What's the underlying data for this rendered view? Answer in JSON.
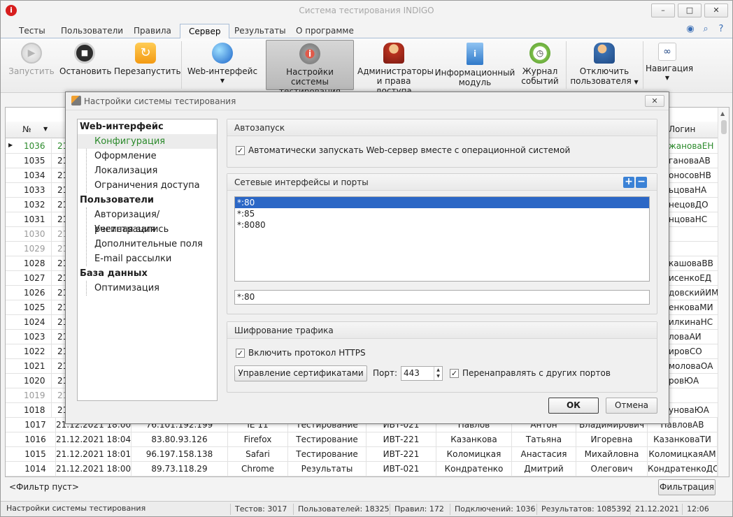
{
  "app": {
    "title": "Система тестирования INDIGO"
  },
  "window_buttons": [
    "–",
    "□",
    "✕"
  ],
  "tabs": [
    {
      "label": "Тесты",
      "active": false
    },
    {
      "label": "Пользователи",
      "active": false
    },
    {
      "label": "Правила",
      "active": false
    },
    {
      "label": "Сервер",
      "active": true
    },
    {
      "label": "Результаты",
      "active": false
    },
    {
      "label": "О программе",
      "active": false
    }
  ],
  "ribbon": {
    "start": "Запустить",
    "stop": "Остановить",
    "restart": "Перезапустить",
    "web": "Web-интерфейс",
    "settings_l1": "Настройки системы",
    "settings_l2": "тестирования",
    "admins_l1": "Администраторы",
    "admins_l2": "и права доступа",
    "info_l1": "Информационный",
    "info_l2": "модуль",
    "journal_l1": "Журнал",
    "journal_l2": "событий",
    "disconnect_l1": "Отключить",
    "disconnect_l2": "пользователя",
    "navigation": "Навигация"
  },
  "grid": {
    "col_no": "№",
    "col_login": "Логин",
    "rows": [
      {
        "no": "1036",
        "date": "21",
        "login": "жановаЕН",
        "sel": true
      },
      {
        "no": "1035",
        "date": "21",
        "login": "гановаАВ"
      },
      {
        "no": "1034",
        "date": "21",
        "login": "оносовНВ"
      },
      {
        "no": "1033",
        "date": "21",
        "login": "ьцоваНА"
      },
      {
        "no": "1032",
        "date": "21",
        "login": "нецовДО"
      },
      {
        "no": "1031",
        "date": "21",
        "login": "нцоваНС"
      },
      {
        "no": "1030",
        "date": "21",
        "login": "",
        "grey": true
      },
      {
        "no": "1029",
        "date": "21",
        "login": "",
        "grey": true
      },
      {
        "no": "1028",
        "date": "21",
        "login": "кашоваВВ"
      },
      {
        "no": "1027",
        "date": "21",
        "login": "исенкоЕД"
      },
      {
        "no": "1026",
        "date": "21",
        "login": "довскийИМ"
      },
      {
        "no": "1025",
        "date": "21",
        "login": "енковаМИ"
      },
      {
        "no": "1024",
        "date": "21",
        "login": "илкинаНС"
      },
      {
        "no": "1023",
        "date": "21",
        "login": "ловаАИ"
      },
      {
        "no": "1022",
        "date": "21",
        "login": "ировСО"
      },
      {
        "no": "1021",
        "date": "21",
        "login": "моловаОА"
      },
      {
        "no": "1020",
        "date": "21",
        "login": "ровЮА"
      },
      {
        "no": "1019",
        "date": "21",
        "login": "",
        "grey": true
      },
      {
        "no": "1018",
        "date": "21",
        "login": "уноваЮА"
      }
    ],
    "full_rows": [
      {
        "no": "1017",
        "date": "21.12.2021 18:00",
        "ip": "76.101.192.199",
        "browser": "IE 11",
        "mode": "Тестирование",
        "group": "ИВТ-021",
        "last": "Павлов",
        "first": "Антон",
        "middle": "Владимирович",
        "login": "ПавловАВ"
      },
      {
        "no": "1016",
        "date": "21.12.2021 18:04",
        "ip": "83.80.93.126",
        "browser": "Firefox",
        "mode": "Тестирование",
        "group": "ИВТ-221",
        "last": "Казанкова",
        "first": "Татьяна",
        "middle": "Игоревна",
        "login": "КазанковаТИ"
      },
      {
        "no": "1015",
        "date": "21.12.2021 18:01",
        "ip": "96.197.158.138",
        "browser": "Safari",
        "mode": "Тестирование",
        "group": "ИВТ-221",
        "last": "Коломицкая",
        "first": "Анастасия",
        "middle": "Михайловна",
        "login": "КоломицкаяАМ"
      },
      {
        "no": "1014",
        "date": "21.12.2021 18:00",
        "ip": "89.73.118.29",
        "browser": "Chrome",
        "mode": "Результаты",
        "group": "ИВТ-021",
        "last": "Кондратенко",
        "first": "Дмитрий",
        "middle": "Олегович",
        "login": "КондратенкоДО"
      }
    ]
  },
  "filter": {
    "text": "<Фильтр пуст>",
    "button": "Фильтрация"
  },
  "status": {
    "left": "Настройки системы тестирования",
    "tests": "Тестов: 3017",
    "users": "Пользователей: 18325",
    "rules": "Правил: 172",
    "conns": "Подключений: 1036",
    "results": "Результатов: 1085392",
    "date": "21.12.2021",
    "time": "12:06"
  },
  "dialog": {
    "title": "Настройки системы тестирования",
    "tree": {
      "web": "Web-интерфейс",
      "config": "Конфигурация",
      "design": "Оформление",
      "locale": "Локализация",
      "access": "Ограничения доступа",
      "users": "Пользователи",
      "auth": "Авторизация/регистрация",
      "account": "Учетная запись",
      "extra": "Дополнительные поля",
      "email": "E-mail рассылки",
      "db": "База данных",
      "optimize": "Оптимизация"
    },
    "autostart": {
      "header": "Автозапуск",
      "check_label": "Автоматически запускать Web-сервер вместе с операционной системой",
      "checked": true
    },
    "network": {
      "header": "Сетевые интерфейсы и порты",
      "items": [
        "*:80",
        "*:85",
        "*:8080"
      ],
      "edit_value": "*:80"
    },
    "encryption": {
      "header": "Шифрование трафика",
      "https_label": "Включить протокол HTTPS",
      "cert_button": "Управление сертификатами",
      "port_label": "Порт:",
      "port_value": "443",
      "redirect_label": "Перенаправлять с других портов"
    },
    "ok": "ОК",
    "cancel": "Отмена"
  }
}
